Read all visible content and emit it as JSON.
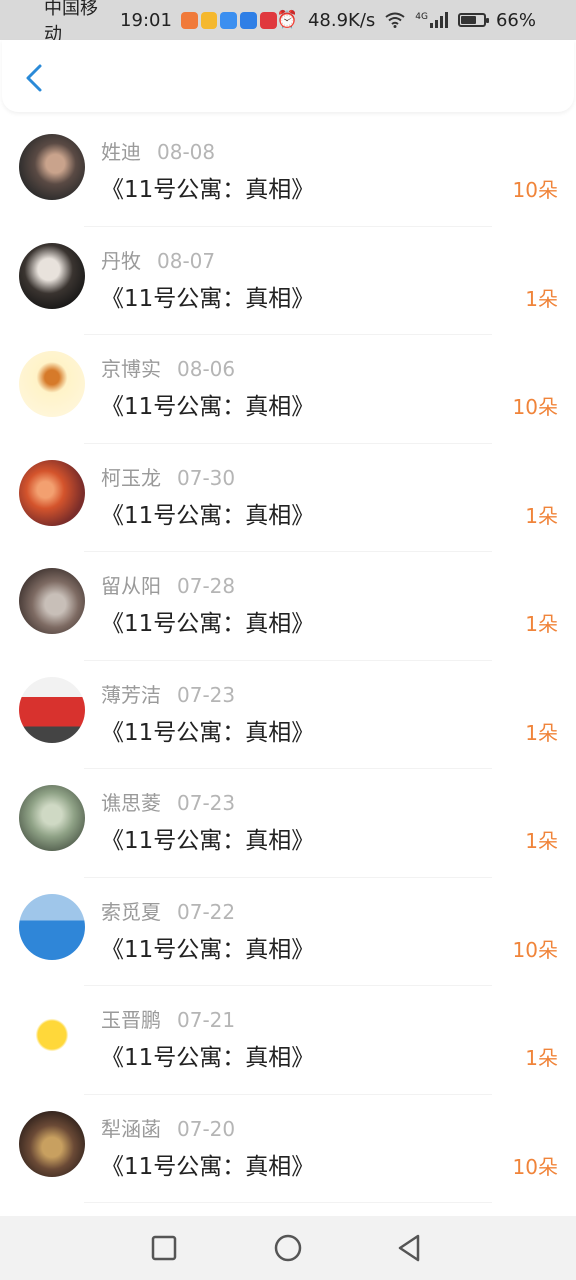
{
  "status": {
    "carrier": "中国移动",
    "time": "19:01",
    "speed": "48.9K/s",
    "network": "4G",
    "battery_percent_label": "66%",
    "battery_level": 0.66,
    "app_icons": [
      "app-icon-orange",
      "app-icon-yellow",
      "app-icon-blue-cloud",
      "app-icon-blue",
      "app-icon-red"
    ]
  },
  "header": {
    "back_icon": "chevron-left-icon",
    "accent": "#2a8ad8"
  },
  "colors": {
    "amount": "#f0843a",
    "name": "#9a9a9a",
    "date": "#b5b5b5",
    "title": "#222222"
  },
  "records": [
    {
      "name": "姓迪",
      "date": "08-08",
      "title": "《11号公寓：真相》",
      "amount": "10朵"
    },
    {
      "name": "丹牧",
      "date": "08-07",
      "title": "《11号公寓：真相》",
      "amount": "1朵"
    },
    {
      "name": "京博实",
      "date": "08-06",
      "title": "《11号公寓：真相》",
      "amount": "10朵"
    },
    {
      "name": "柯玉龙",
      "date": "07-30",
      "title": "《11号公寓：真相》",
      "amount": "1朵"
    },
    {
      "name": "留从阳",
      "date": "07-28",
      "title": "《11号公寓：真相》",
      "amount": "1朵"
    },
    {
      "name": "薄芳洁",
      "date": "07-23",
      "title": "《11号公寓：真相》",
      "amount": "1朵"
    },
    {
      "name": "谯思菱",
      "date": "07-23",
      "title": "《11号公寓：真相》",
      "amount": "1朵"
    },
    {
      "name": "索觅夏",
      "date": "07-22",
      "title": "《11号公寓：真相》",
      "amount": "10朵"
    },
    {
      "name": "玉晋鹏",
      "date": "07-21",
      "title": "《11号公寓：真相》",
      "amount": "1朵"
    },
    {
      "name": "犁涵菡",
      "date": "07-20",
      "title": "《11号公寓：真相》",
      "amount": "10朵"
    }
  ],
  "navbar": {
    "icons": [
      "square-recents-icon",
      "circle-home-icon",
      "triangle-back-icon"
    ]
  }
}
